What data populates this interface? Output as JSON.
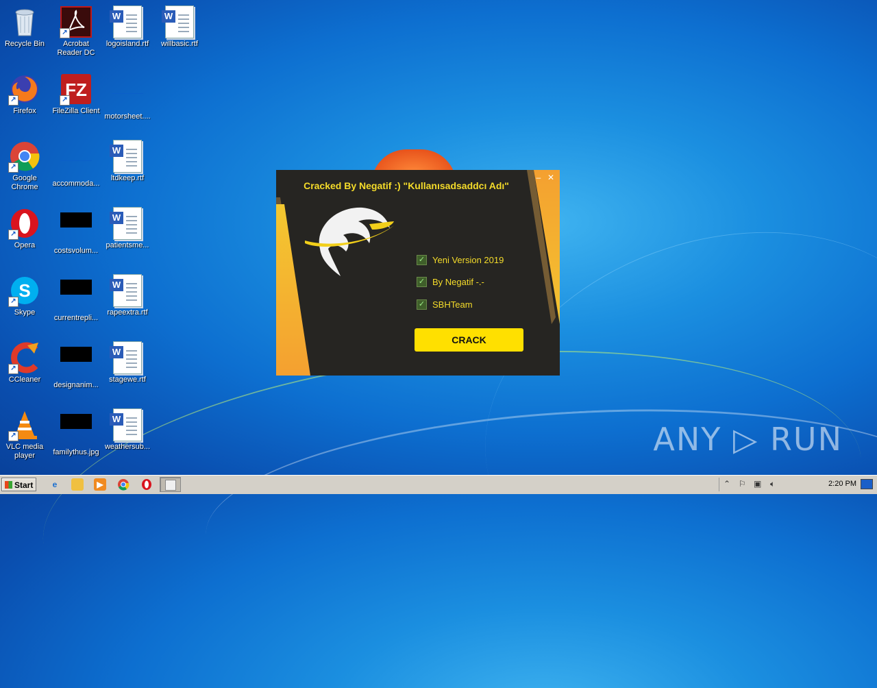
{
  "desktop": {
    "icons": [
      {
        "label": "Recycle Bin",
        "icon": "recycle-bin-icon"
      },
      {
        "label": "Acrobat Reader DC",
        "icon": "acrobat-icon"
      },
      {
        "label": "logoisland.rtf",
        "icon": "word-doc-icon"
      },
      {
        "label": "willbasic.rtf",
        "icon": "word-doc-icon"
      },
      {
        "label": "Firefox",
        "icon": "firefox-icon"
      },
      {
        "label": "FileZilla Client",
        "icon": "filezilla-icon"
      },
      {
        "label": "motorsheet....",
        "icon": "file-icon"
      },
      {
        "label": "Google Chrome",
        "icon": "chrome-icon"
      },
      {
        "label": "accommoda...",
        "icon": "file-icon"
      },
      {
        "label": "ltdkeep.rtf",
        "icon": "word-doc-icon"
      },
      {
        "label": "Opera",
        "icon": "opera-icon"
      },
      {
        "label": "costsvolum...",
        "icon": "image-icon"
      },
      {
        "label": "patientsme...",
        "icon": "word-doc-icon"
      },
      {
        "label": "Skype",
        "icon": "skype-icon"
      },
      {
        "label": "currentrepli...",
        "icon": "image-icon"
      },
      {
        "label": "rapeextra.rtf",
        "icon": "word-doc-icon"
      },
      {
        "label": "CCleaner",
        "icon": "ccleaner-icon"
      },
      {
        "label": "designanim...",
        "icon": "image-icon"
      },
      {
        "label": "stagewe.rtf",
        "icon": "word-doc-icon"
      },
      {
        "label": "VLC media player",
        "icon": "vlc-icon"
      },
      {
        "label": "familythus.jpg",
        "icon": "image-icon"
      },
      {
        "label": "weathersub...",
        "icon": "word-doc-icon"
      }
    ]
  },
  "dialog": {
    "title": "Cracked By Negatif :)  \"Kullanısadsaddcı Adı\"",
    "minimize": "–",
    "close": "✕",
    "checkboxes": [
      {
        "label": "Yeni Version 2019",
        "checked": true
      },
      {
        "label": "By Negatif -.-",
        "checked": true
      },
      {
        "label": "SBHTeam",
        "checked": true
      }
    ],
    "crack_button": "CRACK",
    "accent_color": "#f5dc2a"
  },
  "taskbar": {
    "start_label": "Start",
    "clock": "2:20 PM",
    "pinned": [
      "internet-explorer-icon",
      "folder-icon",
      "media-player-icon",
      "chrome-icon",
      "opera-icon",
      "running-app-icon"
    ]
  },
  "watermark": "ANY ▷ RUN"
}
